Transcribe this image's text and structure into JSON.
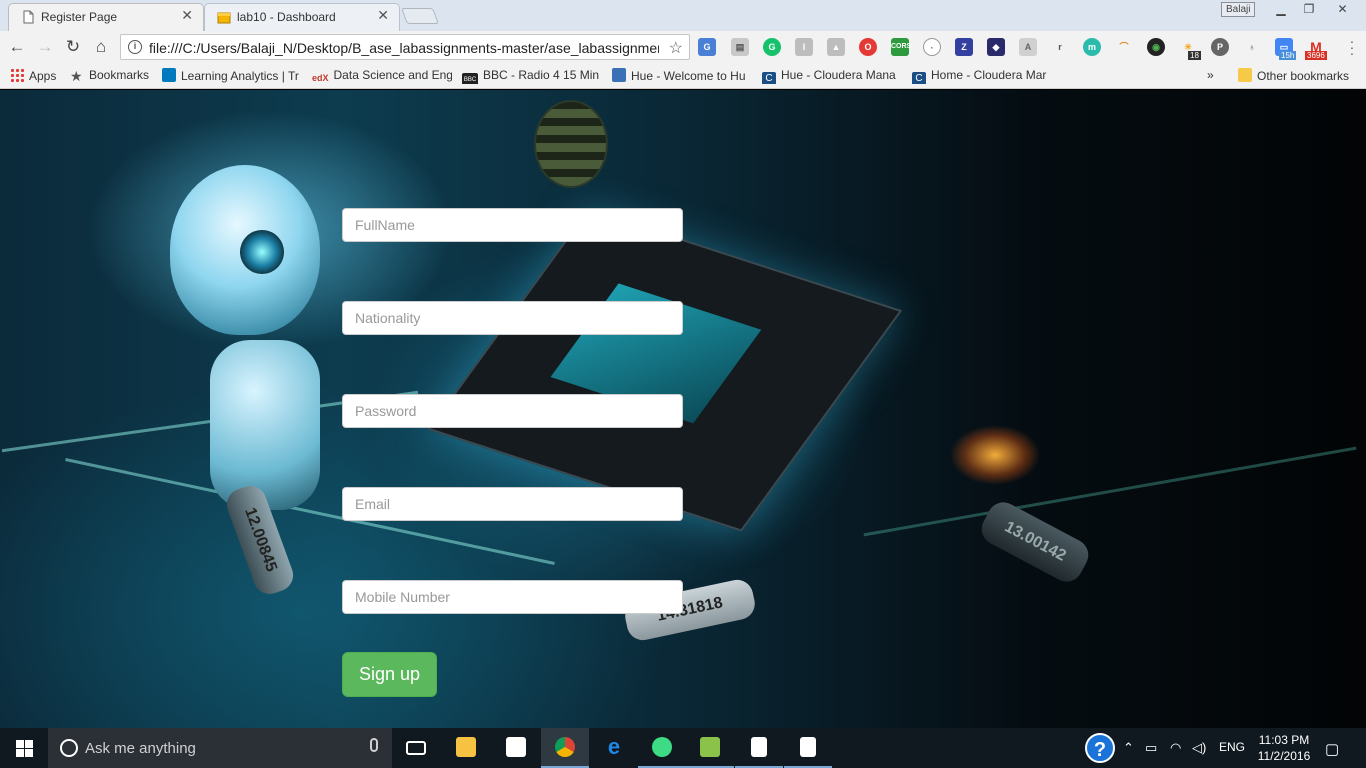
{
  "browser": {
    "tabs": [
      {
        "title": "Register Page",
        "active": true
      },
      {
        "title": "lab10 - Dashboard",
        "active": false
      }
    ],
    "profile_name": "Balaji",
    "url": "file:///C:/Users/Balaji_N/Desktop/B_ase_labassignments-master/ase_labassignments",
    "bookmarks": [
      "Apps",
      "Bookmarks",
      "Learning Analytics | Tr",
      "Data Science and Eng",
      "BBC - Radio 4 15 Min",
      "Hue - Welcome to Hu",
      "Hue - Cloudera Mana",
      "Home - Cloudera Mar"
    ],
    "bookmarks_overflow": "»",
    "other_bookmarks": "Other bookmarks",
    "extension_badges": {
      "badge_18": "18",
      "badge_15h": "15h",
      "badge_3696": "3696"
    }
  },
  "form": {
    "fullname_placeholder": "FullName",
    "nationality_placeholder": "Nationality",
    "password_placeholder": "Password",
    "email_placeholder": "Email",
    "mobile_placeholder": "Mobile Number",
    "signup_label": "Sign up"
  },
  "background": {
    "crystal1": "14.31818",
    "crystal2": "13.00142",
    "crystal3": "12.00845"
  },
  "taskbar": {
    "search_placeholder": "Ask me anything",
    "language": "ENG",
    "time": "11:03 PM",
    "date": "11/2/2016"
  },
  "colors": {
    "signup_button": "#5cb85c",
    "taskbar": "#101820",
    "accent_blue": "#1a73d9"
  }
}
